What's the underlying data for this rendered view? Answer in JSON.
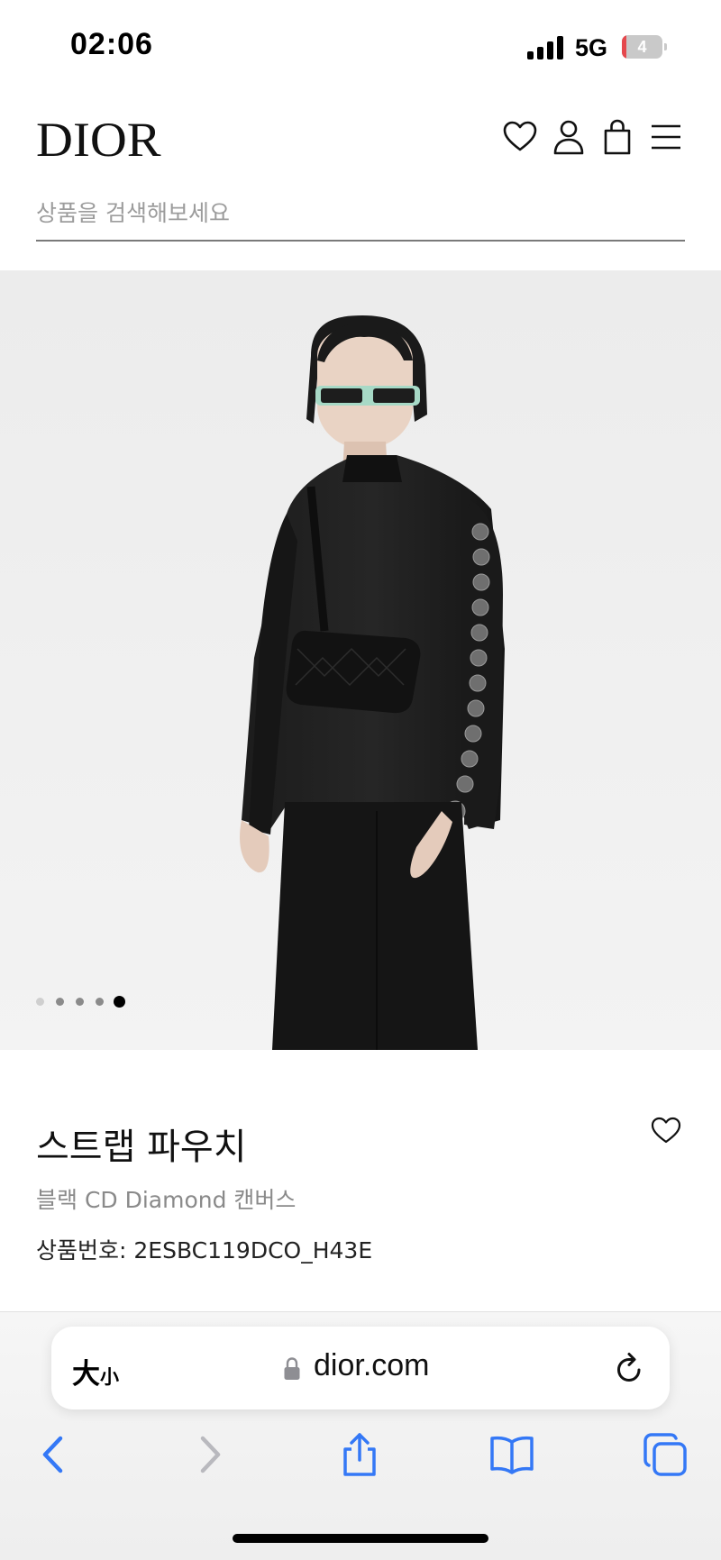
{
  "status_bar": {
    "time": "02:06",
    "network": "5G",
    "battery_level": "4",
    "battery_fill_fraction": 0.12,
    "signal_bars": 4
  },
  "header": {
    "logo_text": "DIOR",
    "icons": [
      "heart-icon",
      "user-icon",
      "bag-icon",
      "menu-icon"
    ]
  },
  "search": {
    "placeholder": "상품을 검색해보세요"
  },
  "carousel": {
    "slide_count": 5,
    "active_index": 4
  },
  "product": {
    "title": "스트랩 파우치",
    "subtitle": "블랙 CD Diamond 캔버스",
    "code": "상품번호: 2ESBC119DCO_H43E"
  },
  "browser": {
    "text_size_label_big": "大",
    "text_size_label_small": "小",
    "url": "dior.com",
    "nav": [
      "back-icon",
      "forward-icon",
      "share-icon",
      "bookmarks-icon",
      "tabs-icon"
    ],
    "accent_color": "#3478f6"
  }
}
